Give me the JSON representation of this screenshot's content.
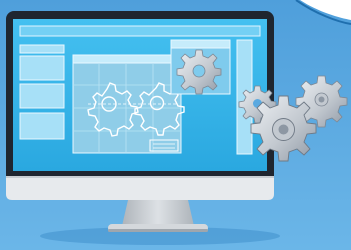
{
  "illustration": {
    "subject": "desktop-monitor-with-cad-gear-drawing",
    "icons": [
      "gear-icon",
      "cog-cluster-icon",
      "blueprint-gear-icon"
    ]
  },
  "colors": {
    "background": "#5aa9e0",
    "background_light": "#7cc0ee",
    "monitor_bezel": "#222a35",
    "screen": "#38b8ec",
    "screen_dark": "#2a9fd6",
    "panel": "#9fdcf6",
    "panel_border": "#e9f7ff",
    "blueprint": "#8ecfe9",
    "gear_silver": "#c8ced6",
    "gear_shadow": "#8d97a3",
    "monitor_chin": "#e6e9ec",
    "stand": "#c9ced3"
  }
}
